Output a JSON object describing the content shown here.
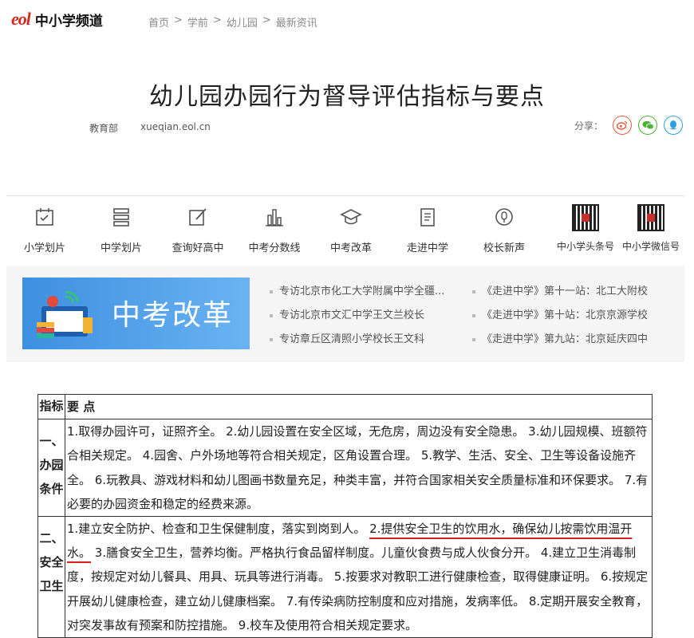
{
  "header": {
    "logo_mark": "eol",
    "logo_text": "中小学频道",
    "breadcrumb": [
      "首页",
      "学前",
      "幼儿园",
      "最新资讯"
    ],
    "breadcrumb_sep": ">"
  },
  "article": {
    "title": "幼儿园办园行为督导评估指标与要点",
    "source": "教育部",
    "site": "xueqian.eol.cn",
    "share_label": "分享："
  },
  "nav": {
    "items": [
      {
        "label": "小学划片",
        "icon": "calendar-icon"
      },
      {
        "label": "中学划片",
        "icon": "stack-icon"
      },
      {
        "label": "查询好高中",
        "icon": "edit-icon"
      },
      {
        "label": "中考分数线",
        "icon": "bar-chart-icon"
      },
      {
        "label": "中考改革",
        "icon": "graduation-cap-icon"
      },
      {
        "label": "走进中学",
        "icon": "document-icon"
      },
      {
        "label": "校长新声",
        "icon": "voice-icon"
      }
    ],
    "qr": [
      {
        "label": "中小学头条号"
      },
      {
        "label": "中小学微信号"
      }
    ]
  },
  "banner": {
    "text": "中考改革",
    "links_left": [
      "专访北京市化工大学附属中学全疆...",
      "专访北京市文汇中学王文兰校长",
      "专访章丘区清照小学校长王文科"
    ],
    "links_right": [
      "《走进中学》第十一站：北工大附校",
      "《走进中学》第十站：北京京源学校",
      "《走进中学》第九站：北京延庆四中"
    ]
  },
  "table": {
    "header": {
      "col1": "指标",
      "col2": "要 点"
    },
    "rows": [
      {
        "category_lines": [
          "一、",
          "办园",
          "条件"
        ],
        "text": "1.取得办园许可，证照齐全。 2.幼儿园设置在安全区域，无危房，周边没有安全隐患。 3.幼儿园规模、班额符合相关规定。 4.园舍、户外场地等符合相关规定，区角设置合理。 5.教学、生活、安全、卫生等设备设施齐全。 6.玩教具、游戏材料和幼儿图画书数量充足，种类丰富，并符合国家相关安全质量标准和环保要求。 7.有必要的办园资金和稳定的经费来源。"
      },
      {
        "category_lines": [
          "二、",
          "安全",
          "卫生"
        ],
        "text_before": "1.建立安全防护、检查和卫生保健制度，落实到岗到人。 ",
        "text_highlight": "2.提供安全卫生的饮用水，确保幼儿按需饮用温开水。",
        "text_after": " 3.膳食安全卫生，营养均衡。严格执行食品留样制度。儿童伙食费与成人伙食分开。 4.建立卫生消毒制度，按规定对幼儿餐具、用具、玩具等进行消毒。 5.按要求对教职工进行健康检查，取得健康证明。 6.按规定开展幼儿健康检查，建立幼儿健康档案。 7.有传染病防控制度和应对措施，发病率低。 8.定期开展安全教育，对突发事故有预案和防控措施。 9.校车及使用符合相关规定要求。"
      }
    ]
  },
  "colors": {
    "brand_red": "#d7261d",
    "banner_blue": "#3d8fe0",
    "highlight_underline": "#d4201d"
  }
}
